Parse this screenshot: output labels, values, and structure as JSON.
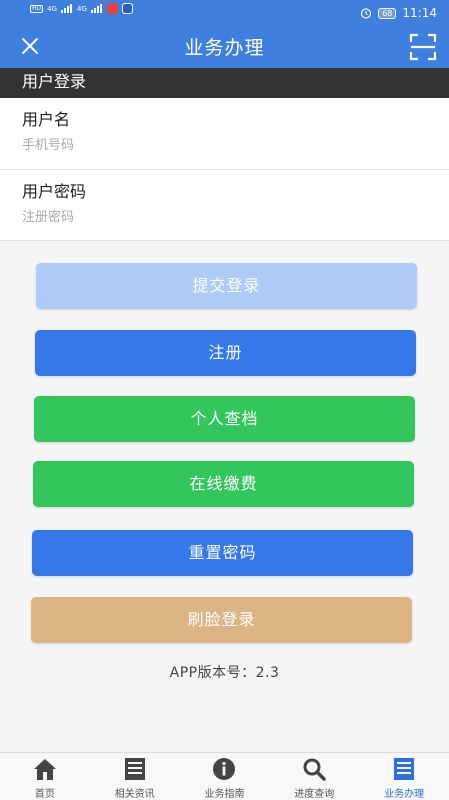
{
  "status_bar": {
    "hd_label": "HD",
    "network_type": "4G",
    "battery": "68",
    "time": "11:14"
  },
  "nav": {
    "title": "业务办理",
    "close_icon": "close-icon",
    "scan_icon": "scan-icon"
  },
  "section": {
    "title": "用户登录"
  },
  "form": {
    "username": {
      "label": "用户名",
      "placeholder": "手机号码",
      "value": ""
    },
    "password": {
      "label": "用户密码",
      "placeholder": "注册密码",
      "value": ""
    }
  },
  "buttons": {
    "submit_login": "提交登录",
    "register": "注册",
    "personal_file": "个人查档",
    "online_payment": "在线缴费",
    "reset_password": "重置密码",
    "face_login": "刷脸登录"
  },
  "version_text": "APP版本号：2.3",
  "tabs": [
    {
      "label": "首页",
      "icon": "home-icon"
    },
    {
      "label": "相关资讯",
      "icon": "news-icon"
    },
    {
      "label": "业务指南",
      "icon": "info-icon"
    },
    {
      "label": "进度查询",
      "icon": "search-icon"
    },
    {
      "label": "业务办理",
      "icon": "business-icon"
    }
  ],
  "colors": {
    "primary_blue": "#3f7fe0",
    "button_blue": "#3478ea",
    "button_blue_disabled": "#aecaf6",
    "button_green": "#33c65d",
    "button_tan": "#dcb585",
    "section_header": "#333333",
    "active_tab": "#2f6fdd"
  }
}
